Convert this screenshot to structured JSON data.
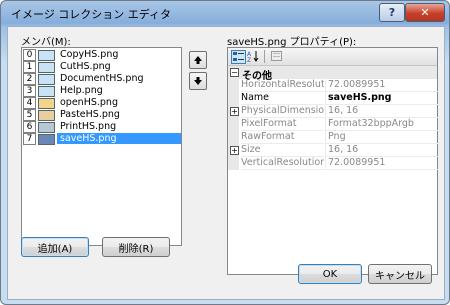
{
  "window": {
    "title": "イメージ コレクション エディタ",
    "help_label": "?",
    "close_label": "✕"
  },
  "members": {
    "label": "メンバ(M):",
    "items": [
      {
        "index": "0",
        "name": "CopyHS.png"
      },
      {
        "index": "1",
        "name": "CutHS.png"
      },
      {
        "index": "2",
        "name": "DocumentHS.png"
      },
      {
        "index": "3",
        "name": "Help.png"
      },
      {
        "index": "4",
        "name": "openHS.png"
      },
      {
        "index": "5",
        "name": "PasteHS.png"
      },
      {
        "index": "6",
        "name": "PrintHS.png"
      },
      {
        "index": "7",
        "name": "saveHS.png"
      }
    ],
    "selected_index": 7,
    "add_label": "追加(A)",
    "remove_label": "削除(R)"
  },
  "properties": {
    "label": "saveHS.png プロパティ(P):",
    "category": "その他",
    "rows": [
      {
        "name": "HorizontalResoluti",
        "value": "72.0089951",
        "expandable": false,
        "bold": false
      },
      {
        "name": "Name",
        "value": "saveHS.png",
        "expandable": false,
        "bold": true
      },
      {
        "name": "PhysicalDimension",
        "value": "16, 16",
        "expandable": true,
        "bold": false
      },
      {
        "name": "PixelFormat",
        "value": "Format32bppArgb",
        "expandable": false,
        "bold": false
      },
      {
        "name": "RawFormat",
        "value": "Png",
        "expandable": false,
        "bold": false
      },
      {
        "name": "Size",
        "value": "16, 16",
        "expandable": true,
        "bold": false
      },
      {
        "name": "VerticalResolution",
        "value": "72.0089951",
        "expandable": false,
        "bold": false
      }
    ]
  },
  "footer": {
    "ok_label": "OK",
    "cancel_label": "キャンセル"
  },
  "icons": {
    "move_up": "up-arrow-icon",
    "move_down": "down-arrow-icon",
    "categorized": "categorized-icon",
    "alphabetical": "alphabetical-sort-icon",
    "property_pages": "property-pages-icon"
  }
}
